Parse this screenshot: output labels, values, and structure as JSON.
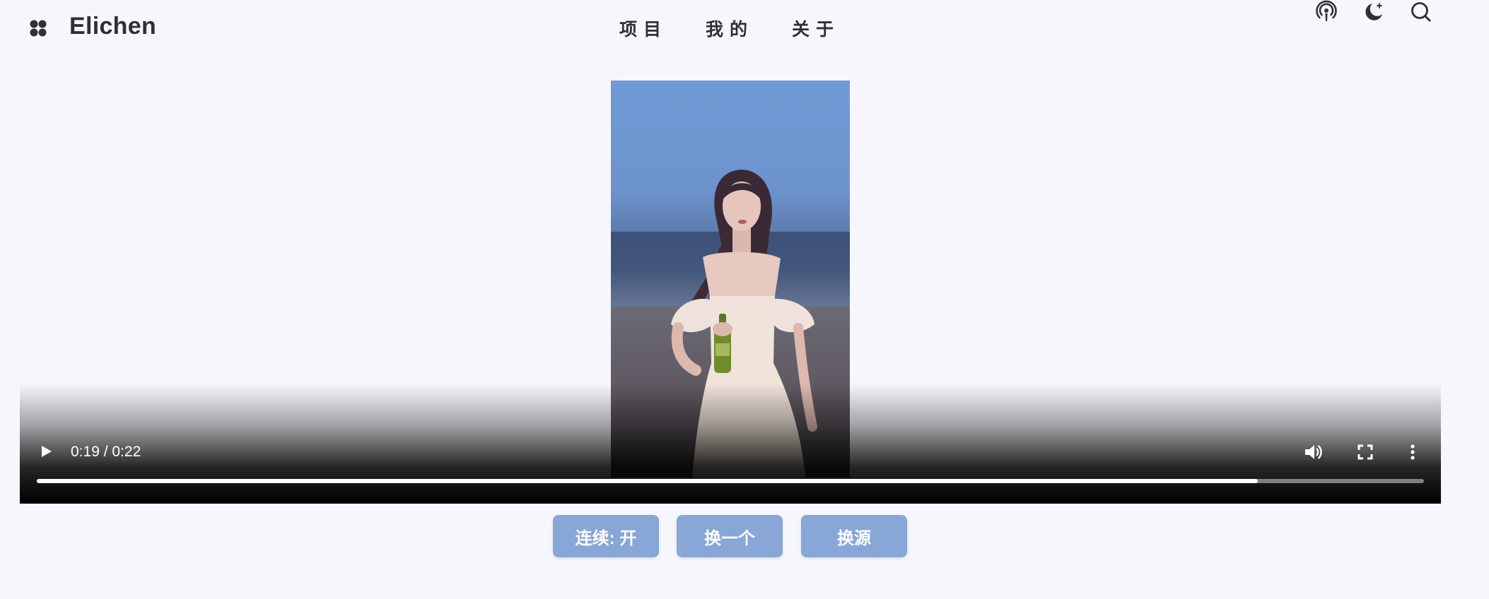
{
  "header": {
    "brand": "Elichen",
    "nav": [
      {
        "label": "项目"
      },
      {
        "label": "我的"
      },
      {
        "label": "关于"
      }
    ],
    "icons": [
      "apps-icon",
      "podcast-icon",
      "dark-mode-icon",
      "search-icon"
    ]
  },
  "player": {
    "time_display": "0:19 / 0:22",
    "current_time": "0:19",
    "duration": "0:22",
    "progress_fraction": 0.88,
    "icons": [
      "play-icon",
      "volume-icon",
      "fullscreen-icon",
      "more-options-icon"
    ]
  },
  "actions": {
    "continuous_label": "连续: 开",
    "next_label": "换一个",
    "switch_source_label": "换源"
  },
  "colors": {
    "background": "#f6f7fc",
    "button": "#88a6d6",
    "text": "#2f3033"
  }
}
